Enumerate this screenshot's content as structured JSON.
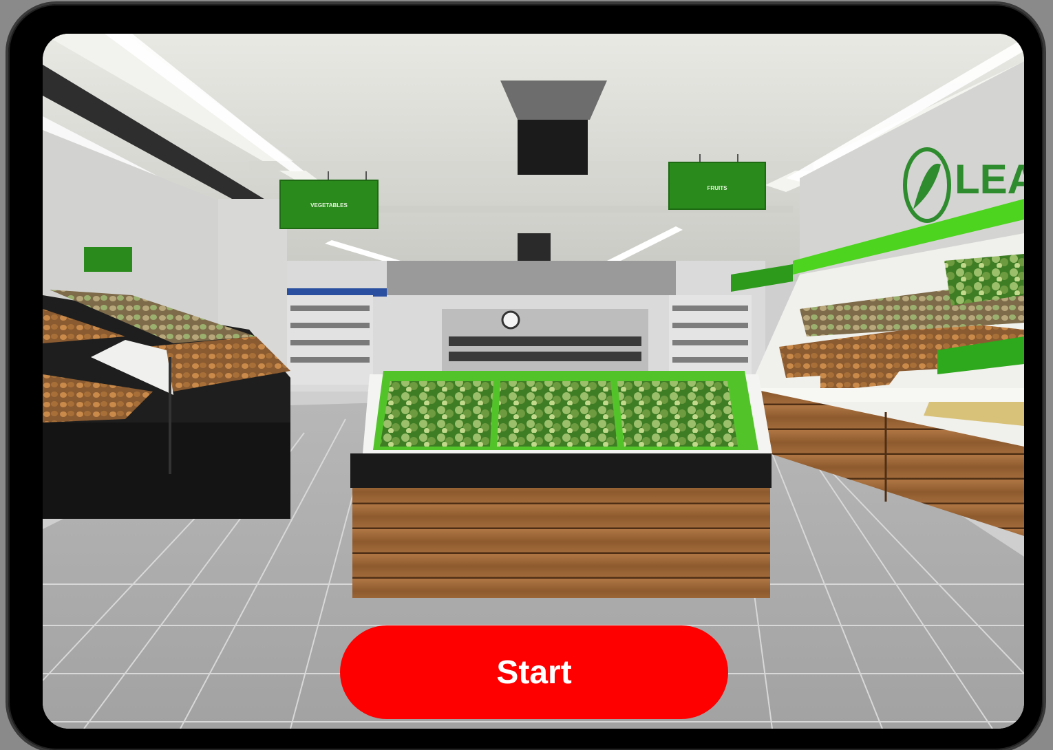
{
  "start_button": {
    "label": "Start"
  },
  "signs": {
    "vegetables": "VEGETABLES",
    "fruits": "FRUITS"
  },
  "store_logo": {
    "text": "LEA"
  },
  "colors": {
    "accent": "#fe0000",
    "store_green": "#2a8a1c",
    "bright_green": "#4cd41e"
  },
  "icons": {
    "logo": "leaf-icon"
  }
}
